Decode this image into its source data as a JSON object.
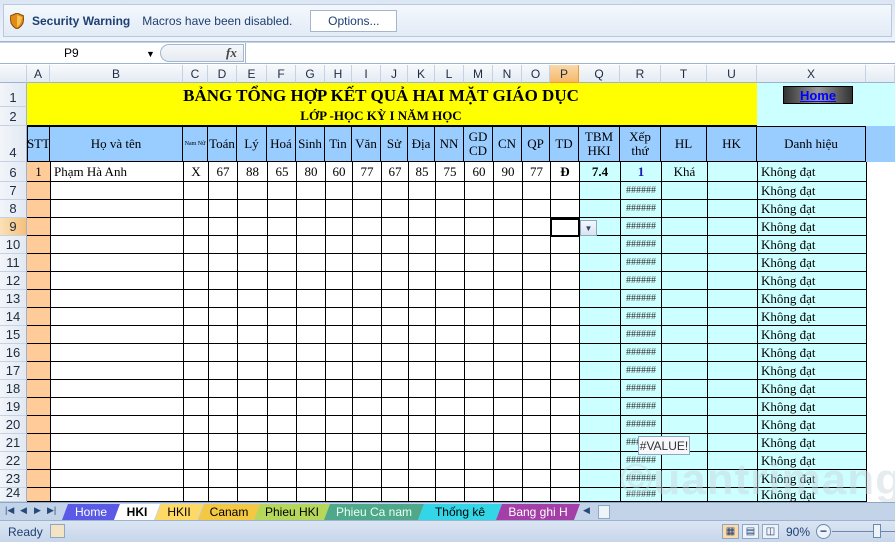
{
  "security_bar": {
    "title": "Security Warning",
    "message": "Macros have been disabled.",
    "options_label": "Options..."
  },
  "formula_bar": {
    "name_box": "P9",
    "fx_label": "fx",
    "content": ""
  },
  "columns": [
    "A",
    "B",
    "C",
    "D",
    "E",
    "F",
    "G",
    "H",
    "I",
    "J",
    "K",
    "L",
    "M",
    "N",
    "O",
    "P",
    "Q",
    "R",
    "T",
    "U",
    "X"
  ],
  "selected_column": "P",
  "row_numbers": [
    "1",
    "2",
    "4",
    "6",
    "7",
    "8",
    "9",
    "10",
    "11",
    "12",
    "13",
    "14",
    "15",
    "16",
    "17",
    "18",
    "19",
    "20",
    "21",
    "22",
    "23",
    "24"
  ],
  "selected_row": "9",
  "sheet": {
    "title": "BẢNG TỔNG HỢP KẾT QUẢ HAI MẶT GIÁO DỤC",
    "subtitle": "LỚP  -HỌC KỲ I NĂM HỌC",
    "home_button": "Home",
    "headers": [
      "STT",
      "Họ và tên",
      "Nam Nữ",
      "Toán",
      "Lý",
      "Hoá",
      "Sinh",
      "Tin",
      "Văn",
      "Sử",
      "Địa",
      "NN",
      "GD CD",
      "CN",
      "QP",
      "TD",
      "TBM HKI",
      "Xếp thứ",
      "HL",
      "HK",
      "Danh hiệu"
    ],
    "student_row": {
      "stt": "1",
      "name": "Phạm Hà Anh",
      "gender": "X",
      "scores": [
        "67",
        "88",
        "65",
        "80",
        "60",
        "77",
        "67",
        "85",
        "75",
        "60",
        "90",
        "77"
      ],
      "td": "Đ",
      "tbm": "7.4",
      "rank": "1",
      "hl": "Khá",
      "hk": "",
      "title": "Không đạt"
    },
    "empty_rank_value": "######",
    "empty_title_value": "Không đạt",
    "error_tooltip": "#VALUE!"
  },
  "sheet_tabs": [
    {
      "label": "Home",
      "bg": "#5a5ae6",
      "color": "#ffffff"
    },
    {
      "label": "HKI",
      "bg": "#ffffff",
      "color": "#000000",
      "active": true
    },
    {
      "label": "HKII",
      "bg": "#ffd966",
      "color": "#000000"
    },
    {
      "label": "Canam",
      "bg": "#f4c842",
      "color": "#000000"
    },
    {
      "label": "Phieu HKI",
      "bg": "#b6d75a",
      "color": "#000000"
    },
    {
      "label": "Phieu Ca nam",
      "bg": "#4fa88a",
      "color": "#e8fff4"
    },
    {
      "label": "Thống kê",
      "bg": "#33d6e6",
      "color": "#000000"
    },
    {
      "label": "Bang ghi H",
      "bg": "#a33fa6",
      "color": "#ffffff"
    }
  ],
  "status_bar": {
    "ready": "Ready",
    "zoom": "90%"
  },
  "colors": {
    "title_bg": "#ffff00",
    "header_bg": "#99ccff",
    "light_cyan": "#ccffff",
    "stt_bg": "#ffcc99",
    "rank_color": "#1a1ab0"
  }
}
